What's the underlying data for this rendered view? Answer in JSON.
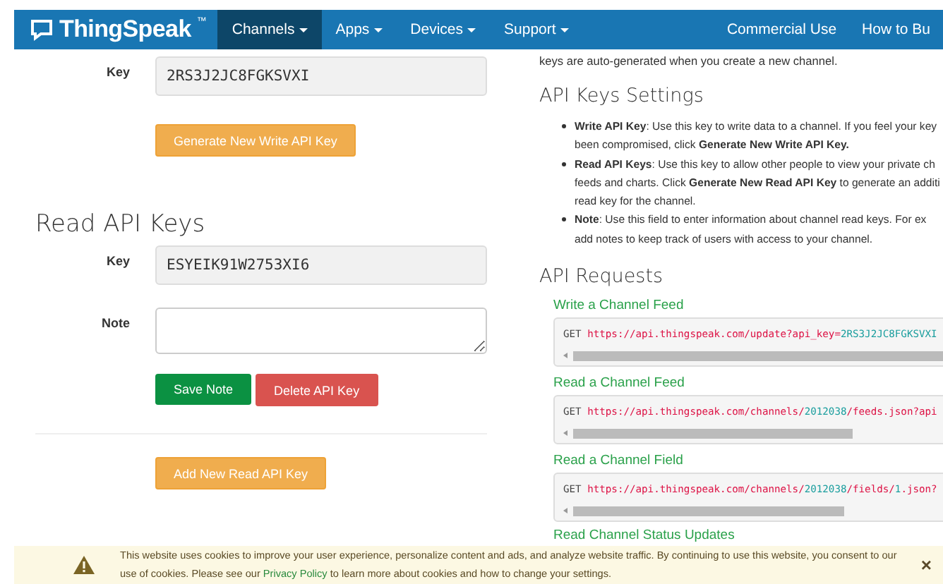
{
  "navbar": {
    "brand": "ThingSpeak",
    "brand_mark": "™",
    "items": [
      {
        "label": "Channels",
        "selected": true
      },
      {
        "label": "Apps",
        "selected": false
      },
      {
        "label": "Devices",
        "selected": false
      },
      {
        "label": "Support",
        "selected": false
      }
    ],
    "right_items": [
      "Commercial Use",
      "How to Bu"
    ]
  },
  "write_key": {
    "label": "Key",
    "value": "2RS3J2JC8FGKSVXI",
    "button": "Generate New Write API Key"
  },
  "read_keys": {
    "heading": "Read API Keys",
    "key_label": "Key",
    "key_value": "ESYEIK91W2753XI6",
    "note_label": "Note",
    "buttons": [
      {
        "kind": "save",
        "label": "Save Note"
      },
      {
        "kind": "delete",
        "label": "Delete API Key"
      }
    ],
    "add_button": "Add New Read API Key"
  },
  "help": {
    "intro": "keys are auto-generated when you create a new channel.",
    "settings_heading": "API Keys Settings",
    "bullets": [
      {
        "lines": [
          "**Write API Key**: Use this key to write data to a channel. If you feel your key",
          "been compromised, click **Generate New Write API Key.**"
        ]
      },
      {
        "lines": [
          "**Read API Keys**: Use this key to allow other people to view your private ch",
          "feeds and charts. Click **Generate New Read API Key** to generate an additi",
          "read key for the channel."
        ]
      },
      {
        "lines": [
          "**Note**: Use this field to enter information about channel read keys. For ex",
          "add notes to keep track of users with access to your channel."
        ]
      }
    ],
    "requests_heading": "API Requests",
    "requests": [
      {
        "title": "Write a Channel Feed",
        "code": [
          {
            "kind": "method",
            "text": "GET "
          },
          {
            "kind": "url",
            "text": "https://api.thingspeak.com/update?api_key="
          },
          {
            "kind": "value",
            "text": "2RS3J2JC8FGKSVXI"
          }
        ]
      },
      {
        "title": "Read a Channel Feed",
        "code": [
          {
            "kind": "method",
            "text": "GET "
          },
          {
            "kind": "url",
            "text": "https://api.thingspeak.com/channels/"
          },
          {
            "kind": "value",
            "text": "2012038"
          },
          {
            "kind": "url",
            "text": "/feeds.json?api"
          }
        ]
      },
      {
        "title": "Read a Channel Field",
        "code": [
          {
            "kind": "method",
            "text": "GET "
          },
          {
            "kind": "url",
            "text": "https://api.thingspeak.com/channels/"
          },
          {
            "kind": "value",
            "text": "2012038"
          },
          {
            "kind": "url",
            "text": "/fields/"
          },
          {
            "kind": "value",
            "text": "1"
          },
          {
            "kind": "url",
            "text": ".json?"
          }
        ]
      }
    ],
    "next_title": "Read Channel Status Updates"
  },
  "cookie_banner": {
    "text": "This website uses cookies to improve your user experience, personalize content and ads, and analyze website traffic. By continuing to use this website, you consent to our use of cookies. Please see our **Privacy Policy** to learn more about cookies and how to change your settings.",
    "close": "×"
  }
}
